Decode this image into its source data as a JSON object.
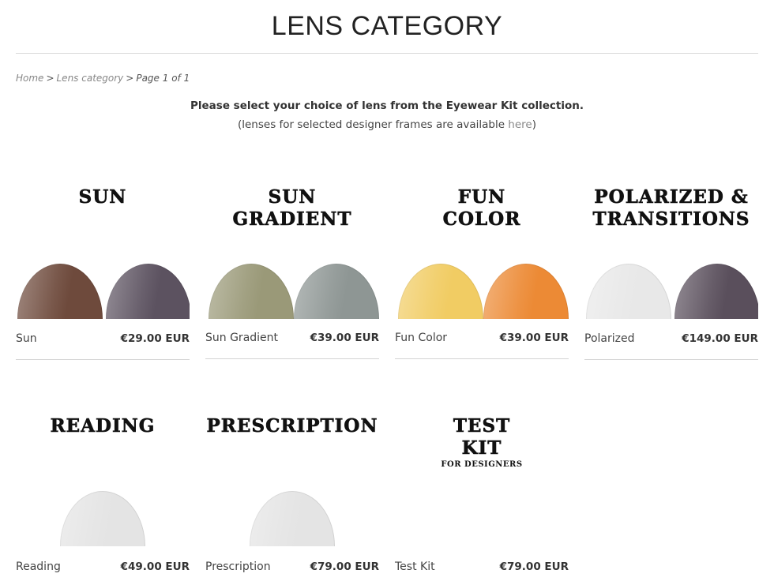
{
  "page": {
    "title": "LENS CATEGORY"
  },
  "breadcrumb": {
    "home": "Home",
    "separator": ">",
    "category": "Lens category",
    "page": "Page 1 of 1"
  },
  "intro": {
    "line1": "Please select your choice of lens from the Eyewear Kit collection.",
    "line2_before": "(lenses for selected designer frames are available ",
    "line2_link": "here",
    "line2_after": ")"
  },
  "categories": [
    {
      "heading_line1": "SUN",
      "heading_line2": "",
      "name": "Sun",
      "price": "€29.00 EUR",
      "lenses": [
        "#6e4a3c",
        "#5c5260"
      ]
    },
    {
      "heading_line1": "SUN",
      "heading_line2": "GRADIENT",
      "name": "Sun Gradient",
      "price": "€39.00 EUR",
      "lenses": [
        "#9a9978",
        "#8e9694"
      ]
    },
    {
      "heading_line1": "FUN",
      "heading_line2": "COLOR",
      "name": "Fun Color",
      "price": "€39.00 EUR",
      "lenses": [
        "#f1cc63",
        "#ec8a35"
      ]
    },
    {
      "heading_line1": "POLARIZED &",
      "heading_line2": "TRANSITIONS",
      "name": "Polarized",
      "price": "€149.00 EUR",
      "lenses": [
        "#e8e8e8",
        "#5a4f5c"
      ]
    },
    {
      "heading_line1": "READING",
      "heading_line2": "",
      "name": "Reading",
      "price": "€49.00 EUR",
      "lenses": [
        "#e4e4e4"
      ]
    },
    {
      "heading_line1": "PRESCRIPTION",
      "heading_line2": "",
      "name": "Prescription",
      "price": "€79.00 EUR",
      "lenses": [
        "#e4e4e4"
      ]
    },
    {
      "heading_line1": "TEST",
      "heading_line2": "KIT",
      "sub": "FOR DESIGNERS",
      "name": "Test Kit",
      "price": "€79.00 EUR",
      "lenses": []
    }
  ]
}
